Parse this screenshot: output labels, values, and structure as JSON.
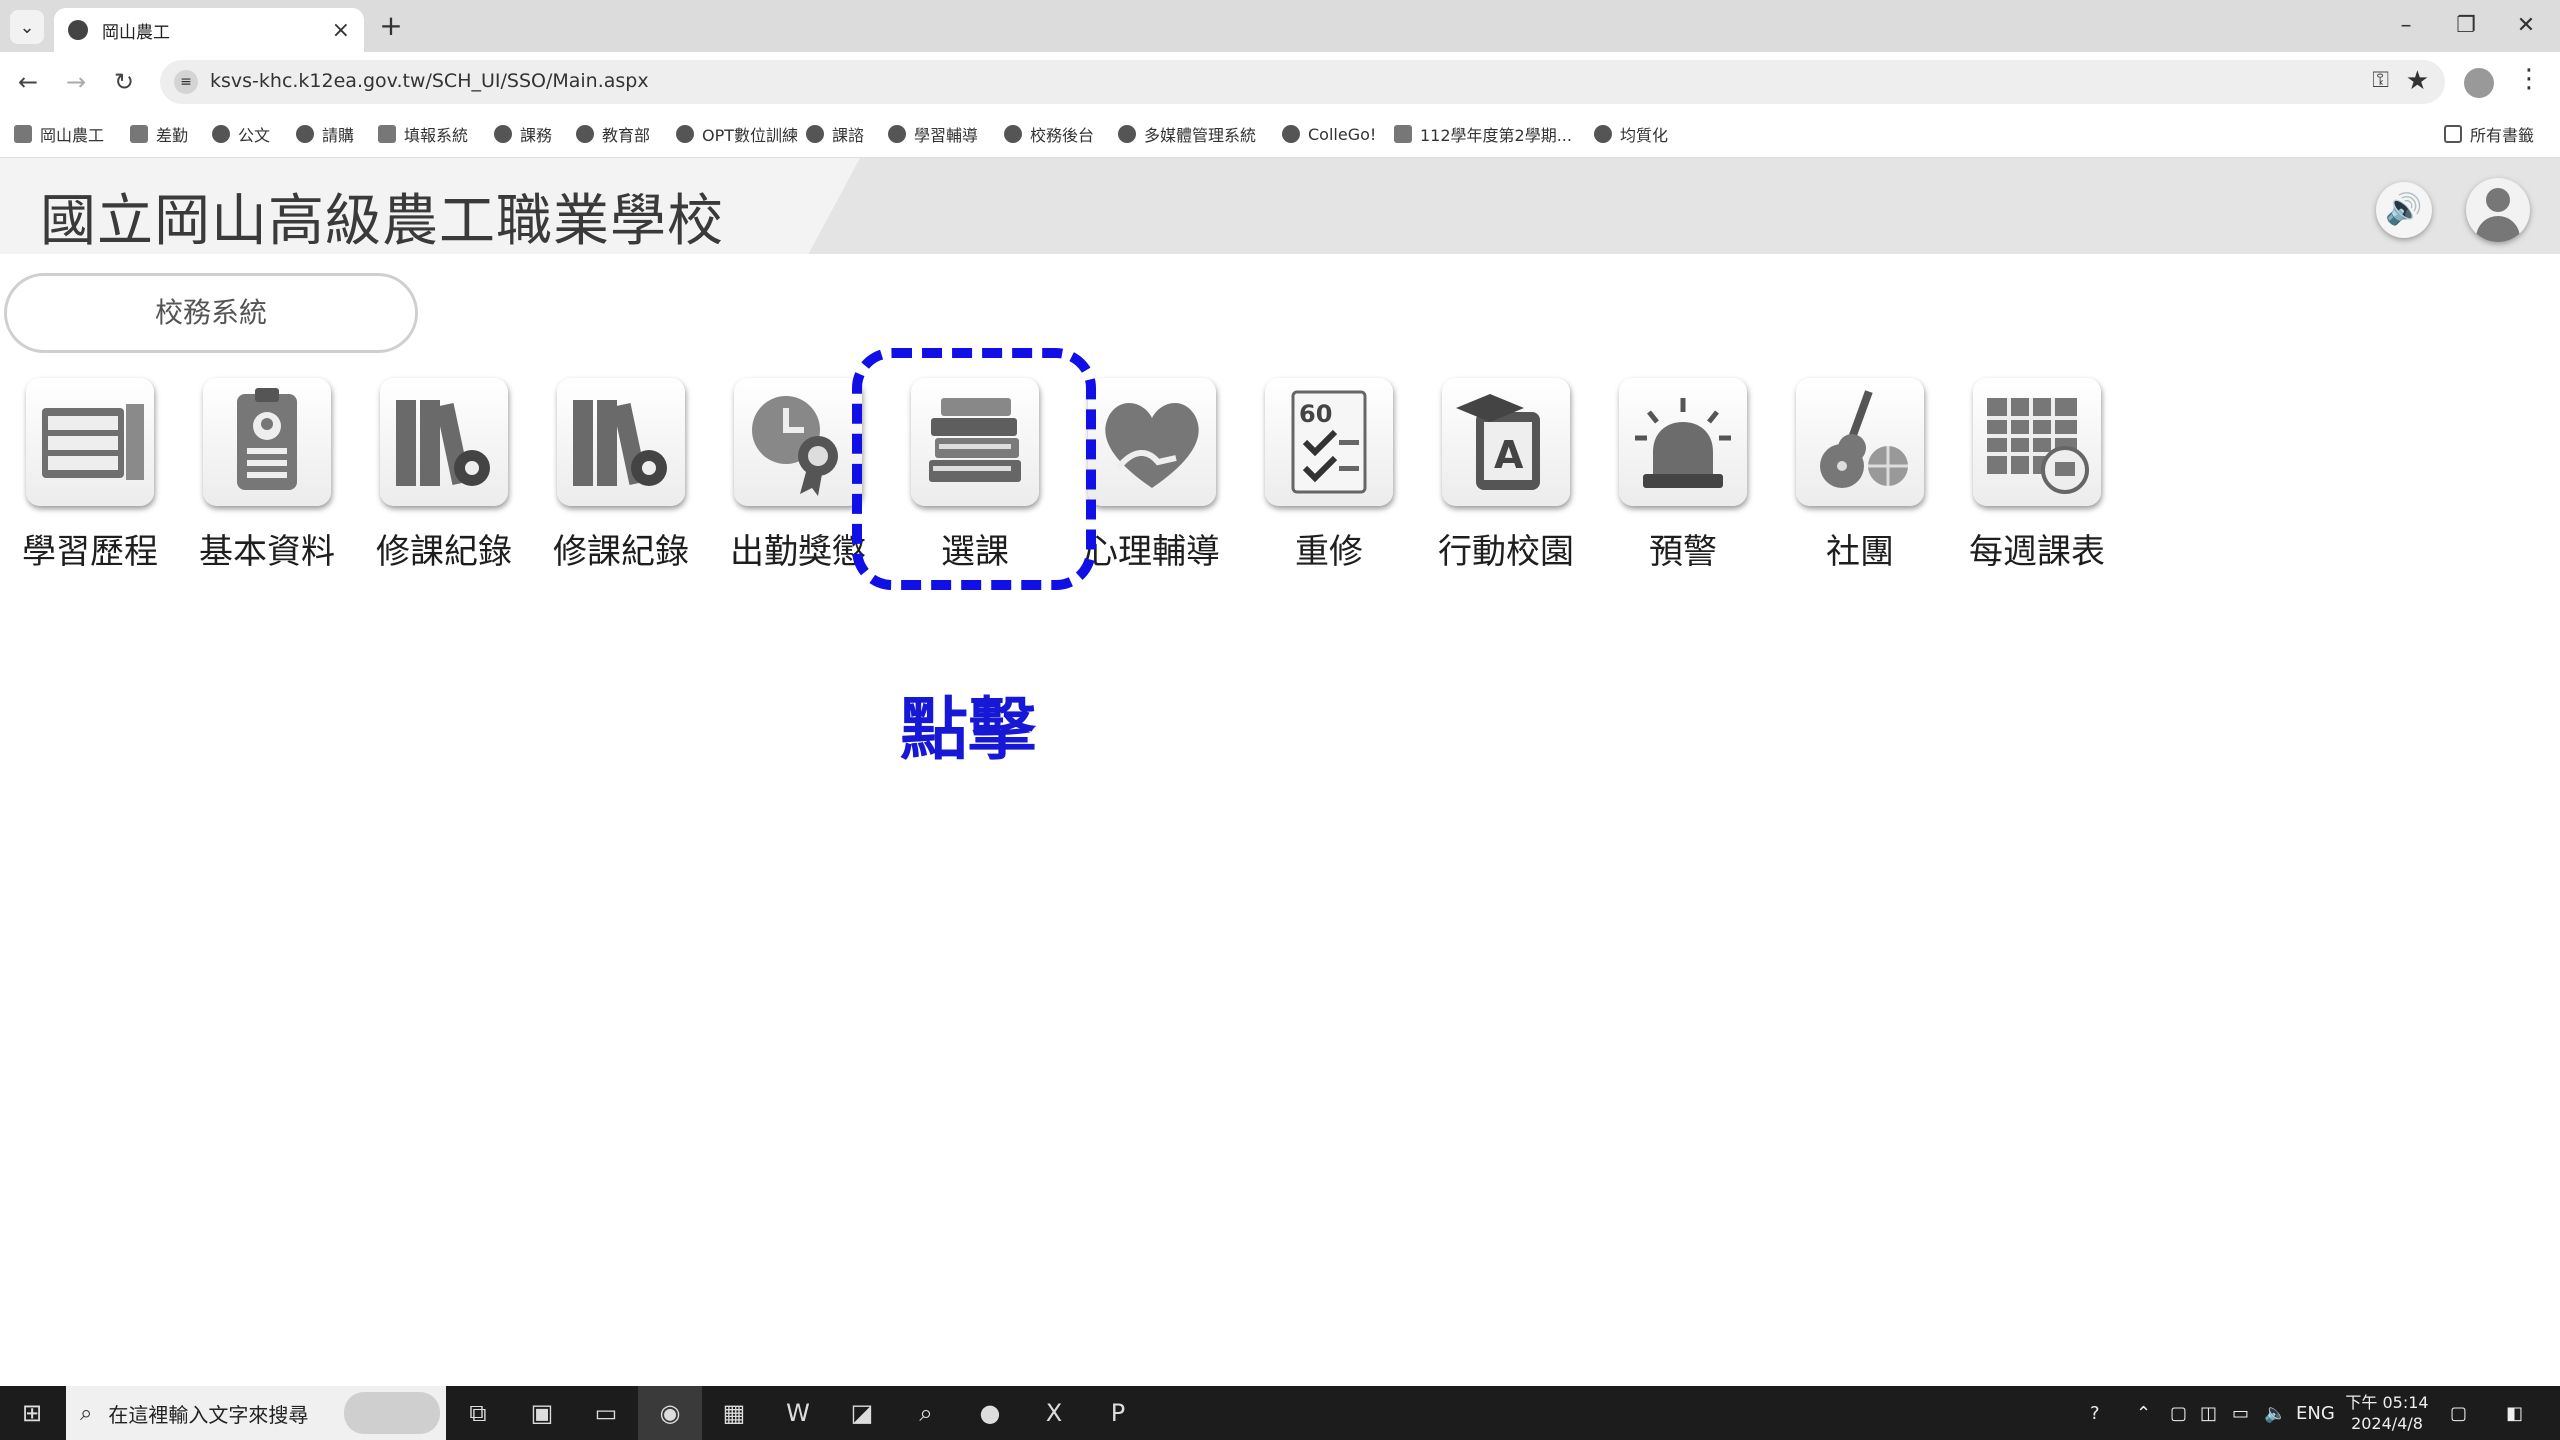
{
  "browser": {
    "tab_title": "岡山農工",
    "tab_close": "×",
    "new_tab": "+",
    "url": "ksvs-khc.k12ea.gov.tw/SCH_UI/SSO/Main.aspx",
    "window_controls": [
      "–",
      "❐",
      "✕"
    ]
  },
  "bookmarks": [
    "岡山農工",
    "差勤",
    "公文",
    "請購",
    "填報系統",
    "課務",
    "教育部",
    "OPT數位訓練",
    "課諮",
    "學習輔導",
    "校務後台",
    "多媒體管理系統",
    "ColleGo!",
    "112學年度第2學期...",
    "均質化"
  ],
  "bookmarks_all": "所有書籤",
  "page": {
    "school_name": "國立岡山高級農工職業學校",
    "system_button": "校務系統",
    "apps": [
      {
        "label": "學習歷程",
        "icon": "cabinet-icon"
      },
      {
        "label": "基本資料",
        "icon": "id-badge-icon"
      },
      {
        "label": "修課紀錄",
        "icon": "binders-gear-icon"
      },
      {
        "label": "修課紀錄",
        "icon": "binders-gear-icon"
      },
      {
        "label": "出勤獎懲",
        "icon": "clock-award-icon"
      },
      {
        "label": "選課",
        "icon": "books-icon"
      },
      {
        "label": "心理輔導",
        "icon": "heart-hands-icon"
      },
      {
        "label": "重修",
        "icon": "exam-checklist-icon"
      },
      {
        "label": "行動校園",
        "icon": "mobile-campus-icon"
      },
      {
        "label": "預警",
        "icon": "alarm-light-icon"
      },
      {
        "label": "社團",
        "icon": "guitar-ball-icon"
      },
      {
        "label": "每週課表",
        "icon": "timetable-icon"
      }
    ],
    "annotation": "點擊",
    "annotation_color": "#1010e6"
  },
  "taskbar": {
    "search_placeholder": "在這裡輸入文字來搜尋",
    "tray_lang": "ENG",
    "time": "下午 05:14",
    "date": "2024/4/8"
  }
}
